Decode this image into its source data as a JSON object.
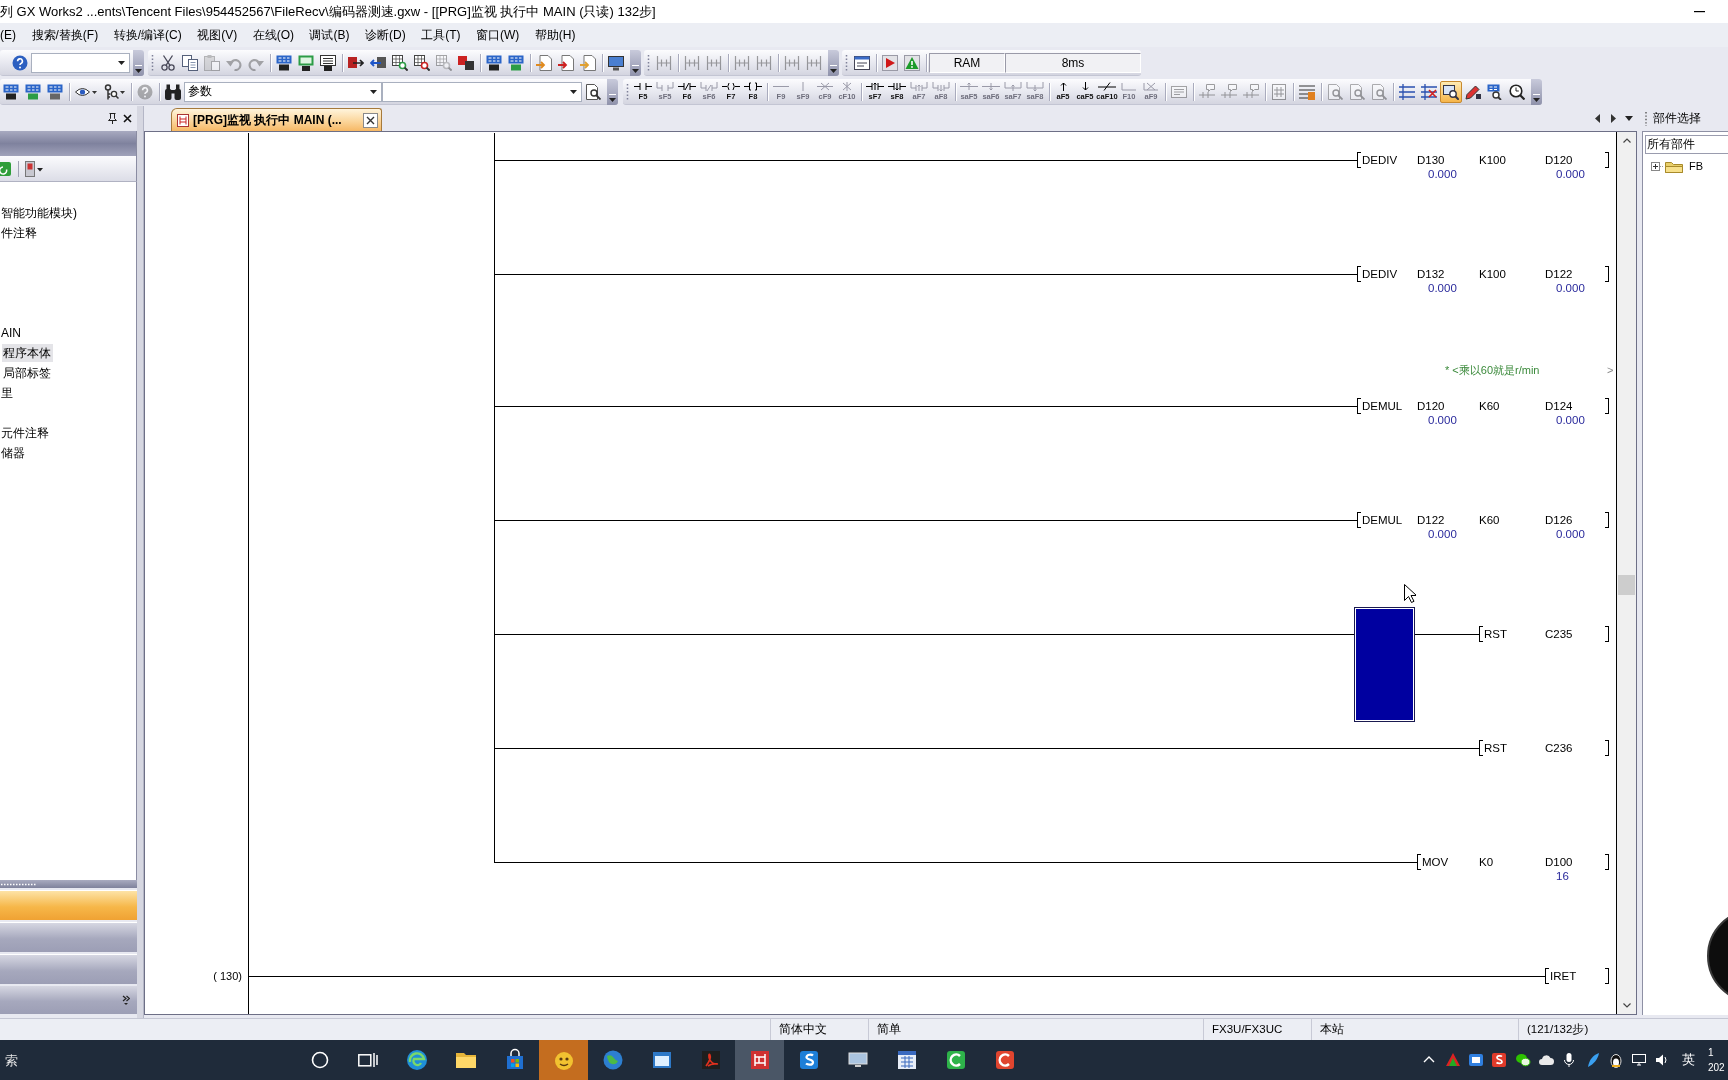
{
  "window": {
    "title": "列 GX Works2 ...ents\\Tencent Files\\954452567\\FileRecv\\编码器测速.gxw - [[PRG]监视 执行中 MAIN (只读) 132步]"
  },
  "menu_bar": [
    "(E)",
    "搜索/替换(F)",
    "转换/编译(C)",
    "视图(V)",
    "在线(O)",
    "调试(B)",
    "诊断(D)",
    "工具(T)",
    "窗口(W)",
    "帮助(H)"
  ],
  "toolbar_rows": [
    [
      {
        "groups": [
          [
            {
              "kind": "button",
              "disabled": false
            },
            {
              "kind": "combo"
            }
          ]
        ]
      },
      {
        "groups": [
          [
            {
              "kind": "button",
              "disabled": false
            },
            {
              "kind": "button",
              "disabled": false
            },
            {
              "kind": "button",
              "disabled": true
            },
            {
              "kind": "button",
              "disabled": true
            },
            {
              "kind": "button",
              "disabled": true
            }
          ],
          [
            {
              "kind": "button",
              "disabled": false
            },
            {
              "kind": "button",
              "disabled": false
            },
            {
              "kind": "button",
              "disabled": false
            }
          ],
          [
            {
              "kind": "button",
              "disabled": false
            },
            {
              "kind": "button",
              "disabled": false
            },
            {
              "kind": "button",
              "disabled": false
            },
            {
              "kind": "button",
              "disabled": false
            },
            {
              "kind": "button",
              "disabled": true
            },
            {
              "kind": "button",
              "disabled": false
            }
          ],
          [
            {
              "kind": "button",
              "disabled": false
            },
            {
              "kind": "button",
              "disabled": false
            }
          ],
          [
            {
              "kind": "button",
              "disabled": false
            },
            {
              "kind": "button",
              "disabled": false
            },
            {
              "kind": "button",
              "disabled": false
            }
          ],
          [
            {
              "kind": "button",
              "disabled": false
            }
          ]
        ]
      },
      {
        "groups": [
          [
            {
              "kind": "button",
              "disabled": true
            }
          ],
          [
            {
              "kind": "button",
              "disabled": true
            },
            {
              "kind": "button",
              "disabled": true
            }
          ],
          [
            {
              "kind": "button",
              "disabled": true
            },
            {
              "kind": "button",
              "disabled": true
            }
          ],
          [
            {
              "kind": "button",
              "disabled": true
            },
            {
              "kind": "button",
              "disabled": true
            }
          ]
        ]
      },
      {
        "groups": [
          [
            {
              "kind": "button",
              "disabled": false
            }
          ],
          [
            {
              "kind": "button",
              "disabled": false
            },
            {
              "kind": "button",
              "disabled": false
            }
          ],
          [
            {
              "kind": "readout",
              "text": "RAM"
            },
            {
              "kind": "readout",
              "text": "8ms"
            }
          ]
        ]
      }
    ],
    [
      {
        "groups": [
          [
            {
              "kind": "button",
              "disabled": false
            },
            {
              "kind": "button",
              "disabled": false
            },
            {
              "kind": "button",
              "disabled": false
            }
          ],
          [
            {
              "kind": "button",
              "disabled": false
            },
            {
              "kind": "button",
              "disabled": false
            }
          ],
          [
            {
              "kind": "button",
              "disabled": true
            }
          ],
          [
            {
              "kind": "button",
              "disabled": false
            },
            {
              "kind": "combo",
              "value": "参数"
            },
            {
              "kind": "combo"
            },
            {
              "kind": "button",
              "disabled": false
            }
          ]
        ]
      },
      {
        "groups": [
          [
            {
              "kind": "key",
              "key": "F5",
              "disabled": false
            },
            {
              "kind": "key",
              "key": "sF5",
              "disabled": true
            },
            {
              "kind": "key",
              "key": "F6",
              "disabled": false
            },
            {
              "kind": "key",
              "key": "sF6",
              "disabled": true
            },
            {
              "kind": "key",
              "key": "F7",
              "disabled": false
            },
            {
              "kind": "key",
              "key": "F8",
              "disabled": false
            }
          ],
          [
            {
              "kind": "key",
              "key": "F9",
              "disabled": true
            },
            {
              "kind": "key",
              "key": "sF9",
              "disabled": true
            },
            {
              "kind": "key",
              "key": "cF9",
              "disabled": true
            },
            {
              "kind": "key",
              "key": "cF10",
              "disabled": true
            }
          ],
          [
            {
              "kind": "key",
              "key": "sF7",
              "disabled": false
            },
            {
              "kind": "key",
              "key": "sF8",
              "disabled": false
            },
            {
              "kind": "key",
              "key": "aF7",
              "disabled": true
            },
            {
              "kind": "key",
              "key": "aF8",
              "disabled": true
            }
          ],
          [
            {
              "kind": "key",
              "key": "saF5",
              "disabled": true
            },
            {
              "kind": "key",
              "key": "saF6",
              "disabled": true
            },
            {
              "kind": "key",
              "key": "saF7",
              "disabled": true
            },
            {
              "kind": "key",
              "key": "saF8",
              "disabled": true
            }
          ],
          [
            {
              "kind": "key",
              "key": "aF5",
              "disabled": false
            },
            {
              "kind": "key",
              "key": "caF5",
              "disabled": false
            },
            {
              "kind": "key",
              "key": "caF10",
              "disabled": false
            },
            {
              "kind": "key",
              "key": "F10",
              "disabled": true
            },
            {
              "kind": "key",
              "key": "aF9",
              "disabled": true
            }
          ],
          [
            {
              "kind": "button",
              "disabled": true
            }
          ],
          [
            {
              "kind": "button",
              "disabled": true
            },
            {
              "kind": "button",
              "disabled": true
            },
            {
              "kind": "button",
              "disabled": true
            }
          ],
          [
            {
              "kind": "button",
              "disabled": true
            }
          ],
          [
            {
              "kind": "button",
              "disabled": false
            }
          ],
          [
            {
              "kind": "button",
              "disabled": true
            },
            {
              "kind": "button",
              "disabled": true
            },
            {
              "kind": "button",
              "disabled": true
            }
          ],
          [
            {
              "kind": "toggle",
              "on": false
            },
            {
              "kind": "toggle",
              "on": false
            },
            {
              "kind": "toggle",
              "on": true
            },
            {
              "kind": "toggle",
              "on": false
            },
            {
              "kind": "toggle",
              "on": false
            },
            {
              "kind": "toggle",
              "on": false
            }
          ]
        ]
      }
    ]
  ],
  "navigator": {
    "tree": [
      {
        "label": "智能功能模块)",
        "selected": false
      },
      {
        "label": "件注释",
        "selected": false
      },
      {
        "label": "AIN",
        "selected": false,
        "children": [
          {
            "label": "程序本体",
            "selected": true
          },
          {
            "label": "局部标签",
            "selected": false
          }
        ]
      },
      {
        "label": "里",
        "selected": false
      },
      {
        "label": "元件注释",
        "selected": false
      },
      {
        "label": "储器",
        "selected": false
      }
    ],
    "sections": [
      {
        "selected": true
      },
      {
        "selected": false
      },
      {
        "selected": false
      }
    ]
  },
  "editor": {
    "tab": {
      "title": "[PRG]监视 执行中 MAIN (...",
      "selected": true
    },
    "rungs": [
      {
        "instruction": "DEDIV",
        "operands": [
          {
            "name": "D130",
            "value": "0.000"
          },
          {
            "name": "K100"
          },
          {
            "name": "D120",
            "value": "0.000"
          }
        ],
        "cursor": false
      },
      {
        "instruction": "DEDIV",
        "operands": [
          {
            "name": "D132",
            "value": "0.000"
          },
          {
            "name": "K100"
          },
          {
            "name": "D122",
            "value": "0.000"
          }
        ],
        "cursor": false
      },
      {
        "comment": "* <乘以60就是r/min",
        "comment_end": ">",
        "instruction": "DEMUL",
        "operands": [
          {
            "name": "D120",
            "value": "0.000"
          },
          {
            "name": "K60"
          },
          {
            "name": "D124",
            "value": "0.000"
          }
        ],
        "cursor": false
      },
      {
        "instruction": "DEMUL",
        "operands": [
          {
            "name": "D122",
            "value": "0.000"
          },
          {
            "name": "K60"
          },
          {
            "name": "D126",
            "value": "0.000"
          }
        ],
        "cursor": false
      },
      {
        "instruction": "RST",
        "operands": [
          {
            "name": "C235"
          }
        ],
        "cursor": true
      },
      {
        "instruction": "RST",
        "operands": [
          {
            "name": "C236"
          }
        ],
        "cursor": false
      },
      {
        "instruction": "MOV",
        "operands": [
          {
            "name": "K0"
          },
          {
            "name": "D100",
            "value": "16"
          }
        ],
        "cursor": false
      },
      {
        "step": "( 130)",
        "instruction": "IRET",
        "cursor": false
      }
    ]
  },
  "parts_panel": {
    "title": "部件选择",
    "filter": "所有部件",
    "tree": [
      {
        "label": "FB",
        "expanded": false
      }
    ]
  },
  "status_bar": [
    "简体中文",
    "简单",
    "FX3U/FX3UC",
    "本站",
    "(121/132步)"
  ],
  "taskbar": {
    "search": {
      "placeholder": "索"
    },
    "apps": [
      {
        "active": false,
        "flashing": false
      },
      {
        "active": false,
        "flashing": false
      },
      {
        "active": false,
        "flashing": false
      },
      {
        "active": false,
        "flashing": true
      },
      {
        "active": false,
        "flashing": false
      },
      {
        "active": false,
        "flashing": false
      },
      {
        "active": false,
        "flashing": false
      },
      {
        "active": true,
        "flashing": false
      },
      {
        "active": false,
        "flashing": false
      },
      {
        "active": false,
        "flashing": false
      },
      {
        "active": false,
        "flashing": false
      },
      {
        "active": false,
        "flashing": false
      },
      {
        "active": false,
        "flashing": false
      }
    ],
    "ime": "英",
    "clock": [
      "1",
      "202"
    ]
  }
}
